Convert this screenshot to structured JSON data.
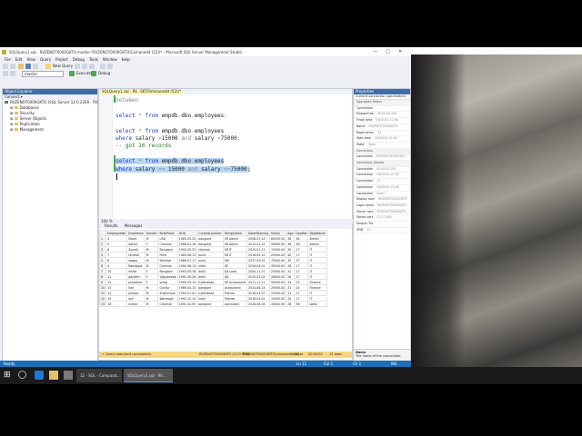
{
  "window": {
    "title": "SQLQuery1.sql - RVZENOT0000GKTO.master (RVZENOT0000GKTO\\Comanedd (52))* - Microsoft SQL Server Management Studio",
    "controls": [
      "—",
      "□",
      "✕"
    ]
  },
  "menu": [
    "File",
    "Edit",
    "View",
    "Query",
    "Project",
    "Debug",
    "Tools",
    "Window",
    "Help"
  ],
  "toolbar": {
    "new_query": "New Query",
    "database": "master",
    "execute": "Execute",
    "debug": "Debug"
  },
  "object_explorer": {
    "title": "Object Explorer",
    "connect": "Connect ▾",
    "server": "RVZENOT0000GKTO (SQL Server 12.0.2269 - RVZEN",
    "nodes": [
      "Databases",
      "Security",
      "Server Objects",
      "Replication",
      "Management"
    ]
  },
  "editor": {
    "tab_label": "SQLQuery1.sql - RV...SKTO\\minanedd (52))*",
    "lines": [
      {
        "parts": [
          {
            "t": "between",
            "c": "gray"
          }
        ]
      },
      {
        "parts": []
      },
      {
        "parts": [
          {
            "t": "select ",
            "c": "kw"
          },
          {
            "t": "* ",
            "c": "gray"
          },
          {
            "t": "from ",
            "c": "kw"
          },
          {
            "t": "empdb",
            "c": ""
          },
          {
            "t": ".",
            "c": "gray"
          },
          {
            "t": "dbo",
            "c": ""
          },
          {
            "t": ".",
            "c": "gray"
          },
          {
            "t": "employees",
            "c": ""
          },
          {
            "t": ";",
            "c": "gray"
          }
        ]
      },
      {
        "parts": []
      },
      {
        "parts": [
          {
            "t": "select ",
            "c": "kw"
          },
          {
            "t": "* ",
            "c": "gray"
          },
          {
            "t": "from ",
            "c": "kw"
          },
          {
            "t": "empdb",
            "c": ""
          },
          {
            "t": ".",
            "c": "gray"
          },
          {
            "t": "dbo",
            "c": ""
          },
          {
            "t": ".",
            "c": "gray"
          },
          {
            "t": "employees",
            "c": ""
          }
        ]
      },
      {
        "parts": [
          {
            "t": "where ",
            "c": "kw"
          },
          {
            "t": "salary ",
            "c": ""
          },
          {
            "t": ">",
            "c": "gray"
          },
          {
            "t": "15000 ",
            "c": ""
          },
          {
            "t": "and ",
            "c": "gray"
          },
          {
            "t": "salary ",
            "c": ""
          },
          {
            "t": "<",
            "c": "gray"
          },
          {
            "t": "75000",
            "c": ""
          },
          {
            "t": ";",
            "c": "gray"
          }
        ]
      },
      {
        "parts": [
          {
            "t": "-- got 10 records",
            "c": "com"
          }
        ]
      },
      {
        "parts": []
      },
      {
        "sel": true,
        "parts": [
          {
            "t": "select ",
            "c": "kw"
          },
          {
            "t": "* ",
            "c": "gray"
          },
          {
            "t": "from ",
            "c": "kw"
          },
          {
            "t": "empdb",
            "c": ""
          },
          {
            "t": ".",
            "c": "gray"
          },
          {
            "t": "dbo",
            "c": ""
          },
          {
            "t": ".",
            "c": "gray"
          },
          {
            "t": "employees",
            "c": ""
          }
        ]
      },
      {
        "sel": true,
        "parts": [
          {
            "t": "where ",
            "c": "kw"
          },
          {
            "t": "salary ",
            "c": ""
          },
          {
            "t": ">= ",
            "c": "gray"
          },
          {
            "t": "15000 ",
            "c": ""
          },
          {
            "t": "and ",
            "c": "gray"
          },
          {
            "t": "salary ",
            "c": ""
          },
          {
            "t": "<=",
            "c": "gray"
          },
          {
            "t": "75000",
            "c": ""
          },
          {
            "t": ";",
            "c": "gray"
          }
        ]
      }
    ],
    "zoom": "100 %",
    "results_tabs": [
      "Results",
      "Messages"
    ]
  },
  "grid": {
    "columns": [
      "",
      "EmployeeNo",
      "EmpName",
      "Gender",
      "BirthPlace",
      "DOB",
      "CurrentLocation",
      "Designation",
      "DateOfJoining",
      "Salary",
      "Age",
      "DeptNo",
      "DeptName"
    ],
    "rows": [
      [
        "1",
        "4",
        "David",
        "M",
        "USA",
        "1983-03-20",
        "banglore",
        "SR Admin",
        "2008-03-14",
        "60000.00",
        "38",
        "46",
        "Admin"
      ],
      [
        "2",
        "5",
        "Sarika",
        "F",
        "Chennai",
        "1988-04-16",
        "banglore",
        "SR Admin",
        "2013-01-15",
        "26000.00",
        "36",
        "46",
        "Admin"
      ],
      [
        "3",
        "6",
        "Suresh",
        "M",
        "Banglore",
        "1990-05-25",
        "chennai",
        "SR IT",
        "2015-01-11",
        "15000.00",
        "30",
        "17",
        "IT"
      ],
      [
        "4",
        "7",
        "ramesh",
        "M",
        "Pune",
        "1980-06-13",
        "pune",
        "SR IT",
        "2016-05-10",
        "25000.00",
        "40",
        "17",
        "IT"
      ],
      [
        "5",
        "8",
        "swaps",
        "M",
        "Mumbai",
        "1989-07-17",
        "pune",
        "SW",
        "2017-09-22",
        "75000.00",
        "35",
        "17",
        "IT"
      ],
      [
        "6",
        "9",
        "Ramappa",
        "M",
        "Chennai",
        "1990-08-13",
        "india",
        "SE",
        "2016-04-01",
        "35000.00",
        "28",
        "17",
        "IT"
      ],
      [
        "7",
        "10",
        "nikita",
        "F",
        "Banglore",
        "1993-09-18",
        "delhi",
        "QA Lead",
        "2000-11-27",
        "25000.00",
        "42",
        "17",
        "IT"
      ],
      [
        "8",
        "11",
        "gayathri",
        "F",
        "Vijayawada",
        "1991-09-26",
        "delhi",
        "QA",
        "2015-02-03",
        "28000.00",
        "26",
        "17",
        "IT"
      ],
      [
        "9",
        "12",
        "pravalika",
        "F",
        "vizag",
        "1995-05-14",
        "hyderabad",
        "SR Accountant",
        "2011-11-11",
        "50000.00",
        "29",
        "25",
        "Finance"
      ],
      [
        "10",
        "13",
        "hari",
        "M",
        "Guntur",
        "1989-04-15",
        "banglore",
        "Accountant",
        "2014-08-15",
        "25000.00",
        "31",
        "25",
        "Finance"
      ],
      [
        "11",
        "14",
        "prasad",
        "M",
        "Khammam",
        "1993-01-01",
        "hyderabad",
        "Trainee",
        "2018-03-07",
        "15000.00",
        "22",
        "17",
        "IT"
      ],
      [
        "12",
        "15",
        "anil",
        "M",
        "Warangal",
        "1992-12-10",
        "india",
        "Trainee",
        "2018-04-01",
        "15000.00",
        "20",
        "17",
        "IT"
      ],
      [
        "13",
        "16",
        "kumar",
        "M",
        "Chennai",
        "1991-04-05",
        "banglore",
        "consultant",
        "2016-06-26",
        "45000.00",
        "28",
        "58",
        "sales"
      ]
    ]
  },
  "query_status": {
    "message": "Query executed successfully.",
    "server": "RVZENOT0000GKTO (12.0 RTM)",
    "user": "RVZENOT0000GKTO\\minanedd (52)",
    "database": "master",
    "time": "00:00:00",
    "rows": "13 rows"
  },
  "properties": {
    "title": "Properties",
    "selector": "Current connection parameters",
    "items": [
      {
        "cat": true,
        "t": "Aggregate Status"
      },
      {
        "t": "Connection",
        "v": ""
      },
      {
        "t": "Elapsed tim",
        "v": "00:00:00.200"
      },
      {
        "t": "Finish time",
        "v": "5/6/2020 12:56"
      },
      {
        "t": "Name",
        "v": "RVZENOT0000GKTO"
      },
      {
        "t": "Rows return",
        "v": "13"
      },
      {
        "t": "Start time",
        "v": "5/6/2020 12:56"
      },
      {
        "t": "State",
        "v": "Open"
      },
      {
        "cat": true,
        "t": "Connection"
      },
      {
        "t": "Connection",
        "v": "RVZENOT0000GKTO"
      },
      {
        "cat": true,
        "t": "Connection Details"
      },
      {
        "t": "Connection",
        "v": "00:00:00.200"
      },
      {
        "t": "Connection",
        "v": "5/6/2020 12:56"
      },
      {
        "t": "Connection",
        "v": "13"
      },
      {
        "t": "Connection",
        "v": "5/6/2020 12:56"
      },
      {
        "t": "Connection",
        "v": "Open"
      },
      {
        "t": "Display nam",
        "v": "RVZENOT0000GKTO"
      },
      {
        "t": "Login name",
        "v": "RVZENOT0000GKTO"
      },
      {
        "t": "Server nam",
        "v": "RVZENOT0000GKTO"
      },
      {
        "t": "Server vers",
        "v": "12.0.2269"
      },
      {
        "t": "Session Tra",
        "v": ""
      },
      {
        "t": "SPID",
        "v": "52"
      }
    ],
    "desc_title": "Name",
    "desc_text": "The name of the connection."
  },
  "app_status": {
    "ready": "Ready",
    "ln": "Ln 11",
    "col": "Col 1",
    "ch": "Ch 1",
    "ins": "INS"
  },
  "taskbar": {
    "apps": [
      {
        "label": "32 - SQL - Comparat...",
        "active": false
      },
      {
        "label": "SQLQuery1.sql - RV...",
        "active": true
      }
    ]
  }
}
